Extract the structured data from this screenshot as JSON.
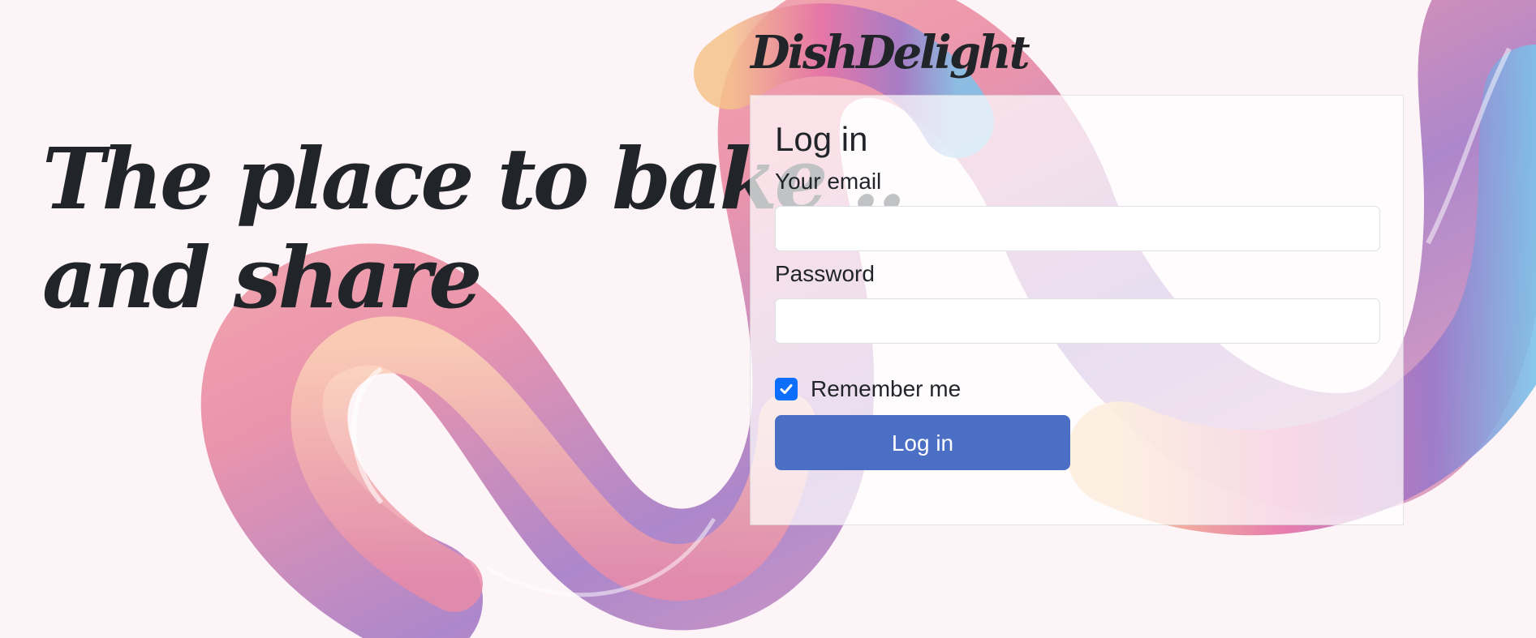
{
  "brand": {
    "name": "DishDelight"
  },
  "hero": {
    "line1": "The place to bake ..",
    "line2": "and share"
  },
  "login_form": {
    "title": "Log in",
    "email_label": "Your email",
    "email_value": "",
    "password_label": "Password",
    "password_value": "",
    "remember_label": "Remember me",
    "remember_checked": true,
    "submit_label": "Log in"
  },
  "colors": {
    "page_background": "#fdf4f7",
    "text": "#212529",
    "button": "#4a6fc4",
    "checkbox": "#0d6efd"
  },
  "icons": [
    "checkmark-icon"
  ]
}
